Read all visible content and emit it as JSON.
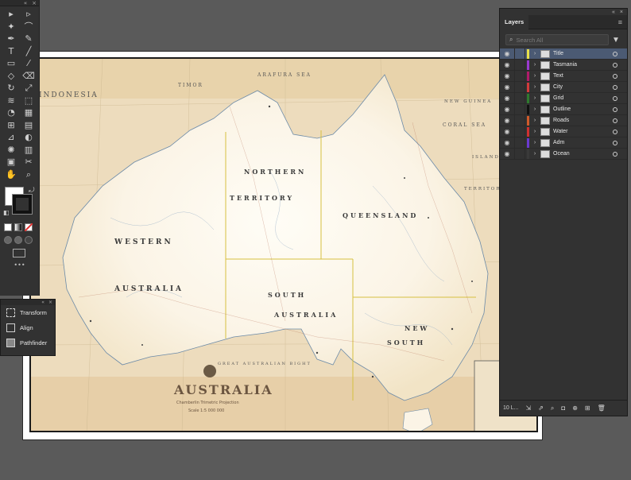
{
  "app": {
    "name": "Illustrator-like workspace"
  },
  "tools_panel": {
    "close": "×",
    "collapse": "«",
    "more": "•••",
    "items": [
      {
        "icon": "selection-tool-icon"
      },
      {
        "icon": "direct-selection-tool-icon"
      },
      {
        "icon": "magic-wand-tool-icon"
      },
      {
        "icon": "lasso-tool-icon"
      },
      {
        "icon": "pen-tool-icon"
      },
      {
        "icon": "curvature-tool-icon"
      },
      {
        "icon": "type-tool-icon",
        "glyph": "T"
      },
      {
        "icon": "line-segment-tool-icon"
      },
      {
        "icon": "rectangle-tool-icon"
      },
      {
        "icon": "paintbrush-tool-icon"
      },
      {
        "icon": "shaper-tool-icon"
      },
      {
        "icon": "eraser-tool-icon"
      },
      {
        "icon": "rotate-tool-icon"
      },
      {
        "icon": "scale-tool-icon"
      },
      {
        "icon": "width-tool-icon"
      },
      {
        "icon": "free-transform-tool-icon"
      },
      {
        "icon": "shape-builder-tool-icon"
      },
      {
        "icon": "perspective-grid-tool-icon"
      },
      {
        "icon": "mesh-tool-icon"
      },
      {
        "icon": "gradient-tool-icon"
      },
      {
        "icon": "eyedropper-tool-icon"
      },
      {
        "icon": "blend-tool-icon"
      },
      {
        "icon": "symbol-sprayer-tool-icon"
      },
      {
        "icon": "column-graph-tool-icon"
      },
      {
        "icon": "artboard-tool-icon"
      },
      {
        "icon": "slice-tool-icon"
      },
      {
        "icon": "hand-tool-icon"
      },
      {
        "icon": "zoom-tool-icon"
      }
    ]
  },
  "float_panel": {
    "items": [
      {
        "label": "Transform",
        "icon": "transform-icon"
      },
      {
        "label": "Align",
        "icon": "align-icon"
      },
      {
        "label": "Pathfinder",
        "icon": "pathfinder-icon"
      }
    ]
  },
  "layers_panel": {
    "tab": "Layers",
    "search_placeholder": "Search All",
    "layers": [
      {
        "name": "Title",
        "color": "#e8e04a",
        "selected": true
      },
      {
        "name": "Tasmania",
        "color": "#9a3ad0",
        "selected": false
      },
      {
        "name": "Text",
        "color": "#b01a6a",
        "selected": false
      },
      {
        "name": "City",
        "color": "#d23b3b",
        "selected": false
      },
      {
        "name": "Grid",
        "color": "#2e7a2e",
        "selected": false
      },
      {
        "name": "Outline",
        "color": "#111111",
        "selected": false
      },
      {
        "name": "Roads",
        "color": "#d05a2a",
        "selected": false
      },
      {
        "name": "Water",
        "color": "#d03030",
        "selected": false
      },
      {
        "name": "Adm",
        "color": "#6a3ad0",
        "selected": false
      },
      {
        "name": "Ocean",
        "color": "#3a3a3a",
        "selected": false
      }
    ],
    "footer_count": "10 L..."
  },
  "map": {
    "title": "AUSTRALIA",
    "projection": "Chamberlin Trimetric Projection",
    "scale": "Scale 1:5 000 000",
    "regions": {
      "western": "WESTERN",
      "australia_wa": "AUSTRALIA",
      "northern": "NORTHERN",
      "territory": "TERRITORY",
      "queensland": "QUEENSLAND",
      "south": "SOUTH",
      "australia_sa": "AUSTRALIA",
      "new": "NEW",
      "south_wales": "SOUTH"
    },
    "seas": {
      "indonesia": "INDONESIA",
      "timor": "TIMOR",
      "arafura": "ARAFURA SEA",
      "coral": "CORAL SEA",
      "new_guinea": "NEW GUINEA",
      "islands": "ISLANDS",
      "territory_right": "TERRITORY",
      "great_bight": "GREAT AUSTRALIAN BIGHT"
    }
  }
}
